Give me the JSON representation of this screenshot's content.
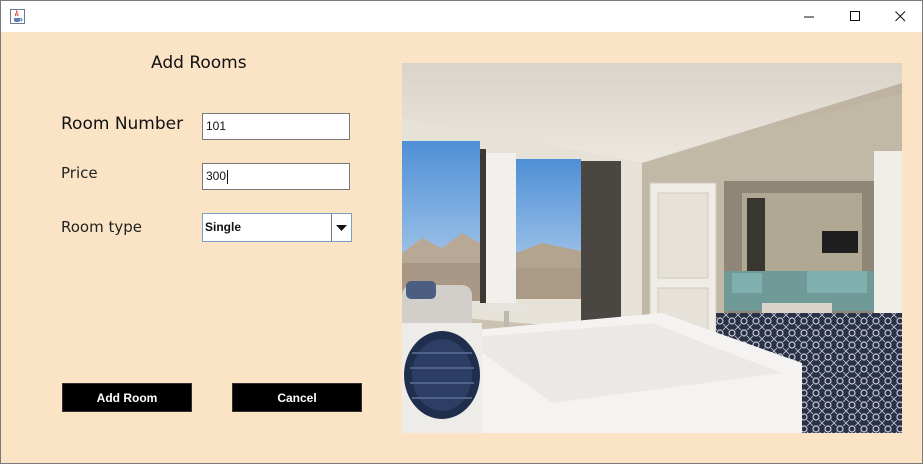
{
  "window": {
    "app_icon": "java-cup-icon",
    "controls": {
      "minimize": "—",
      "maximize": "☐",
      "close": "✕"
    }
  },
  "form": {
    "heading": "Add Rooms",
    "room_number_label": "Room Number",
    "room_number_value": "101",
    "price_label": "Price",
    "price_value": "300",
    "room_type_label": "Room type",
    "room_type_value": "Single",
    "add_button": "Add Room",
    "cancel_button": "Cancel"
  },
  "image": {
    "subject": "hotel-room-photo"
  },
  "colors": {
    "background": "#fbe4c6",
    "button": "#000000",
    "button_text": "#ffffff"
  }
}
